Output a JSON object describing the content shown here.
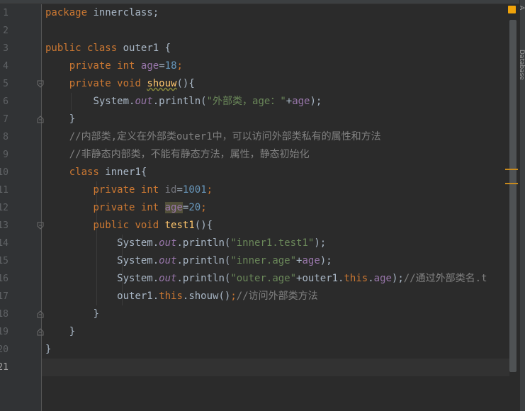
{
  "side_panel": {
    "tab_top": "A",
    "tab_database": "Database"
  },
  "line_numbers": [
    "1",
    "2",
    "3",
    "4",
    "5",
    "6",
    "7",
    "8",
    "9",
    "10",
    "11",
    "12",
    "13",
    "14",
    "15",
    "16",
    "17",
    "18",
    "19",
    "20",
    "21"
  ],
  "code": {
    "l1": {
      "kw": "package",
      "rest": " innerclass;"
    },
    "l3": {
      "kw1": "public",
      "kw2": "class",
      "name": "outer1 {"
    },
    "l4": {
      "kw1": "private",
      "kw2": "int",
      "field": "age",
      "eq": "=",
      "num": "18",
      "end": ";"
    },
    "l5": {
      "kw1": "private",
      "kw2": "void",
      "fn": "shouw",
      "end": "(){"
    },
    "l6": {
      "sys": "System.",
      "out": "out",
      "call": ".println(",
      "str": "\"外部类，age：\"",
      "plus": "+",
      "field": "age",
      "end": ");"
    },
    "l7": {
      "text": "}"
    },
    "l8": {
      "comment": "//内部类,定义在外部类outer1中，可以访问外部类私有的属性和方法"
    },
    "l9": {
      "comment": "//非静态内部类，不能有静态方法，属性，静态初始化"
    },
    "l10": {
      "kw": "class",
      "name": " inner1{"
    },
    "l11": {
      "kw1": "private",
      "kw2": "int",
      "field": "id",
      "eq": "=",
      "num": "1001",
      "end": ";"
    },
    "l12": {
      "kw1": "private",
      "kw2": "int",
      "field": "age",
      "eq": "=",
      "num": "20",
      "end": ";"
    },
    "l13": {
      "kw1": "public",
      "kw2": "void",
      "fn": "test1",
      "end": "(){"
    },
    "l14": {
      "sys": "System.",
      "out": "out",
      "call": ".println(",
      "str": "\"inner1.test1\"",
      "end": ");"
    },
    "l15": {
      "sys": "System.",
      "out": "out",
      "call": ".println(",
      "str": "\"inner.age\"",
      "plus": "+",
      "field": "age",
      "end": ");"
    },
    "l16": {
      "sys": "System.",
      "out": "out",
      "call": ".println(",
      "str": "\"outer.age\"",
      "plus": "+outer1.",
      "this": "this",
      "dot": ".",
      "field": "age",
      "end": ");",
      "comment": "//通过外部类名.t"
    },
    "l17": {
      "obj": "outer1.",
      "this": "this",
      "call": ".shouw()",
      "end": ";",
      "comment": "//访问外部类方法"
    },
    "l18": {
      "text": "}"
    },
    "l19": {
      "text": "}"
    },
    "l20": {
      "text": "}"
    }
  }
}
